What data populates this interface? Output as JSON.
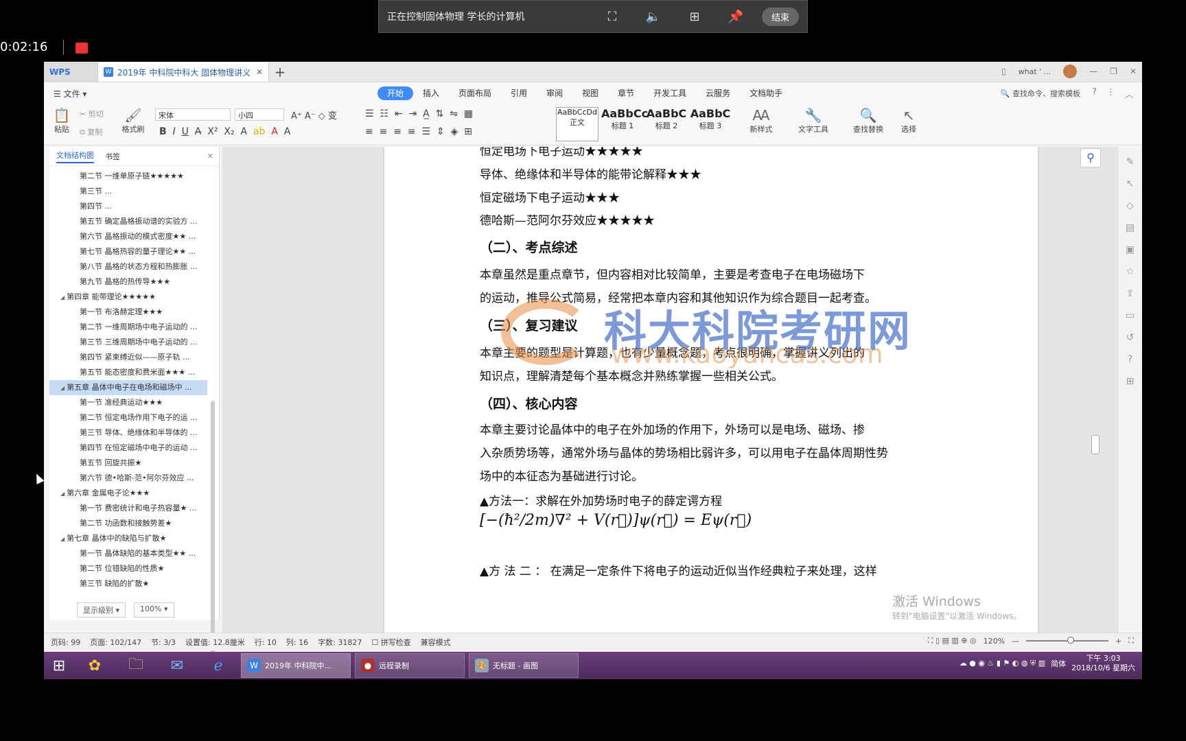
{
  "remote": {
    "status_text": "正在控制固体物理 学长的计算机",
    "end_button": "结束"
  },
  "recording": {
    "timer": "0:02:16"
  },
  "window": {
    "app_tab": "WPS",
    "doc_tab": "2019年 中科院中科大 固体物理讲义",
    "user_name": "what ' ..."
  },
  "menu": {
    "file": "文件",
    "items": [
      "开始",
      "插入",
      "页面布局",
      "引用",
      "审阅",
      "视图",
      "章节",
      "开发工具",
      "云服务",
      "文档助手"
    ],
    "search": "查找命令、搜索模板"
  },
  "ribbon": {
    "paste": "粘贴",
    "cut": "剪切",
    "copy": "复制",
    "format_painter": "格式刷",
    "font_name": "宋体",
    "font_size": "小四",
    "styles": [
      {
        "sample": "AaBbCcDd",
        "name": "正文"
      },
      {
        "sample": "AaBbCc",
        "name": "标题 1"
      },
      {
        "sample": "AaBbC",
        "name": "标题 2"
      },
      {
        "sample": "AaBbC",
        "name": "标题 3"
      }
    ],
    "new_style": "新样式",
    "text_tools": "文字工具",
    "find_replace": "查找替换",
    "select": "选择"
  },
  "nav": {
    "tab_outline": "文档结构图",
    "tab_bookmark": "书签",
    "items": [
      {
        "level": 2,
        "text": "第二节 一维单原子链★★★★★"
      },
      {
        "level": 2,
        "text": "第三节 ..."
      },
      {
        "level": 2,
        "text": "第四节 ..."
      },
      {
        "level": 2,
        "text": "第五节 确定晶格振动谱的实验方 ..."
      },
      {
        "level": 2,
        "text": "第六节 晶格振动的模式密度★★ ..."
      },
      {
        "level": 2,
        "text": "第七节 晶格热容的量子理论★★ ..."
      },
      {
        "level": 2,
        "text": "第八节 晶格的状态方程和热膨胀 ..."
      },
      {
        "level": 2,
        "text": "第九节 晶格的热传导★★★"
      },
      {
        "level": 1,
        "text": "第四章 能带理论★★★★★"
      },
      {
        "level": 2,
        "text": "第一节 布洛赫定理★★★"
      },
      {
        "level": 2,
        "text": "第二节 一维周期场中电子运动的 ..."
      },
      {
        "level": 2,
        "text": "第三节 三维周期场中电子运动的 ..."
      },
      {
        "level": 2,
        "text": "第四节 紧束缚近似——原子轨 ..."
      },
      {
        "level": 2,
        "text": "第五节 能态密度和费米面★★★ ..."
      },
      {
        "level": 1,
        "text": "第五章 晶体中电子在电场和磁场中 ...",
        "selected": true
      },
      {
        "level": 2,
        "text": "第一节 准经典运动★★★"
      },
      {
        "level": 2,
        "text": "第二节 恒定电场作用下电子的运 ..."
      },
      {
        "level": 2,
        "text": "第三节 导体、绝缘体和半导体的 ..."
      },
      {
        "level": 2,
        "text": "第四节 在恒定磁场中电子的运动 ..."
      },
      {
        "level": 2,
        "text": "第五节 回旋共振★"
      },
      {
        "level": 2,
        "text": "第六节 德•哈斯-范•阿尔芬效应 ..."
      },
      {
        "level": 1,
        "text": "第六章 金属电子论★★★"
      },
      {
        "level": 2,
        "text": "第一节 费密统计和电子热容量★ ..."
      },
      {
        "level": 2,
        "text": "第二节 功函数和接触势差★"
      },
      {
        "level": 1,
        "text": "第七章 晶体中的缺陷与扩散★"
      },
      {
        "level": 2,
        "text": "第一节 晶体缺陷的基本类型★★ ..."
      },
      {
        "level": 2,
        "text": "第二节 位错缺陷的性质★"
      },
      {
        "level": 2,
        "text": "第三节 缺陷的扩散★"
      }
    ],
    "display_level": "显示级别",
    "zoom": "100%"
  },
  "document": {
    "lines": [
      {
        "type": "p",
        "text": "恒定电场下电子运动★★★★★"
      },
      {
        "type": "p",
        "text": "导体、绝缘体和半导体的能带论解释★★★"
      },
      {
        "type": "p",
        "text": "恒定磁场下电子运动★★★"
      },
      {
        "type": "p",
        "text": "德哈斯—范阿尔芬效应★★★★★"
      },
      {
        "type": "h",
        "text": "（二）、考点综述"
      },
      {
        "type": "p",
        "text": "    本章虽然是重点章节，但内容相对比较简单，主要是考查电子在电场磁场下"
      },
      {
        "type": "p",
        "text": "的运动，推导公式简易，经常把本章内容和其他知识作为综合题目一起考查。"
      },
      {
        "type": "h",
        "text": "（三）、复习建议"
      },
      {
        "type": "p",
        "text": "    本章主要的题型是计算题，也有少量概念题，考点很明确，掌握讲义列出的"
      },
      {
        "type": "p",
        "text": "知识点，理解清楚每个基本概念并熟练掌握一些相关公式。"
      },
      {
        "type": "h",
        "text": "（四）、核心内容"
      },
      {
        "type": "p",
        "text": "    本章主要讨论晶体中的电子在外加场的作用下，外场可以是电场、磁场、掺"
      },
      {
        "type": "p",
        "text": "入杂质势场等，通常外场与晶体的势场相比弱许多，可以用电子在晶体周期性势"
      },
      {
        "type": "p",
        "text": "场中的本征态为基础进行讨论。"
      },
      {
        "type": "p",
        "text": "▲方法一：求解在外加势场时电子的薛定谔方程"
      },
      {
        "type": "p",
        "text": "▲方 法 二 ： 在满足一定条件下将电子的运动近似当作经典粒子来处理，这样"
      }
    ],
    "formula": "[−(ħ²/2m)∇² + V(r⃗)]ψ(r⃗) = Eψ(r⃗)",
    "watermark_title": "科大科院考研网",
    "watermark_url": "www.kaoyancas.com"
  },
  "activation": {
    "title": "激活 Windows",
    "subtitle": "转到\"电脑设置\"以激活 Windows。"
  },
  "status": {
    "page_num": "页码: 99",
    "page": "页面: 102/147",
    "section": "节: 3/3",
    "setting": "设置值: 12.8厘米",
    "row": "行: 10",
    "col": "列: 16",
    "word_count": "字数: 31827",
    "spell_check": "拼写检查",
    "compat": "兼容模式",
    "zoom": "120%"
  },
  "taskbar": {
    "tasks": [
      {
        "label": "2019年 中科院中...",
        "active": true
      },
      {
        "label": "远程录制",
        "active": false
      },
      {
        "label": "无标题 - 画图",
        "active": false
      }
    ],
    "ime": "简体",
    "time": "下午 3:03",
    "date": "2018/10/6 星期六"
  }
}
